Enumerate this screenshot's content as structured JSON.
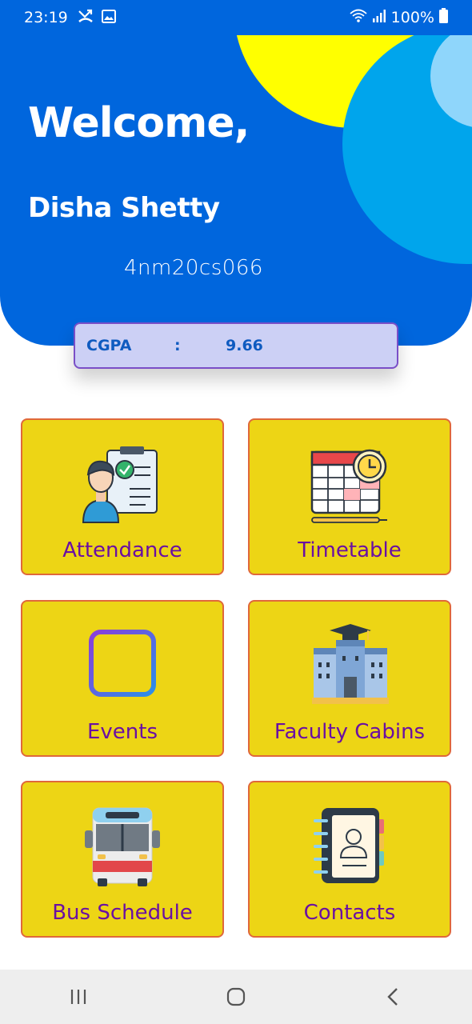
{
  "status_bar": {
    "time": "23:19",
    "battery": "100%"
  },
  "header": {
    "greeting": "Welcome,",
    "student_name": "Disha Shetty",
    "usn": "4nm20cs066"
  },
  "cgpa": {
    "label": "CGPA",
    "separator": ":",
    "value": "9.66"
  },
  "tiles": [
    {
      "label": "Attendance",
      "icon": "attendance-icon"
    },
    {
      "label": "Timetable",
      "icon": "timetable-icon"
    },
    {
      "label": "Events",
      "icon": "calendar-icon"
    },
    {
      "label": "Faculty Cabins",
      "icon": "building-icon"
    },
    {
      "label": "Bus Schedule",
      "icon": "bus-icon"
    },
    {
      "label": "Contacts",
      "icon": "contacts-book-icon"
    }
  ],
  "colors": {
    "header_bg": "#0066dd",
    "tile_bg": "#edd515",
    "tile_border": "#e0683a",
    "tile_label": "#6a0fa3",
    "cgpa_bg": "#ccd0f5",
    "cgpa_text": "#0f5bc0"
  },
  "nav": {
    "recents_icon": "recents-icon",
    "home_icon": "home-icon",
    "back_icon": "back-icon"
  }
}
